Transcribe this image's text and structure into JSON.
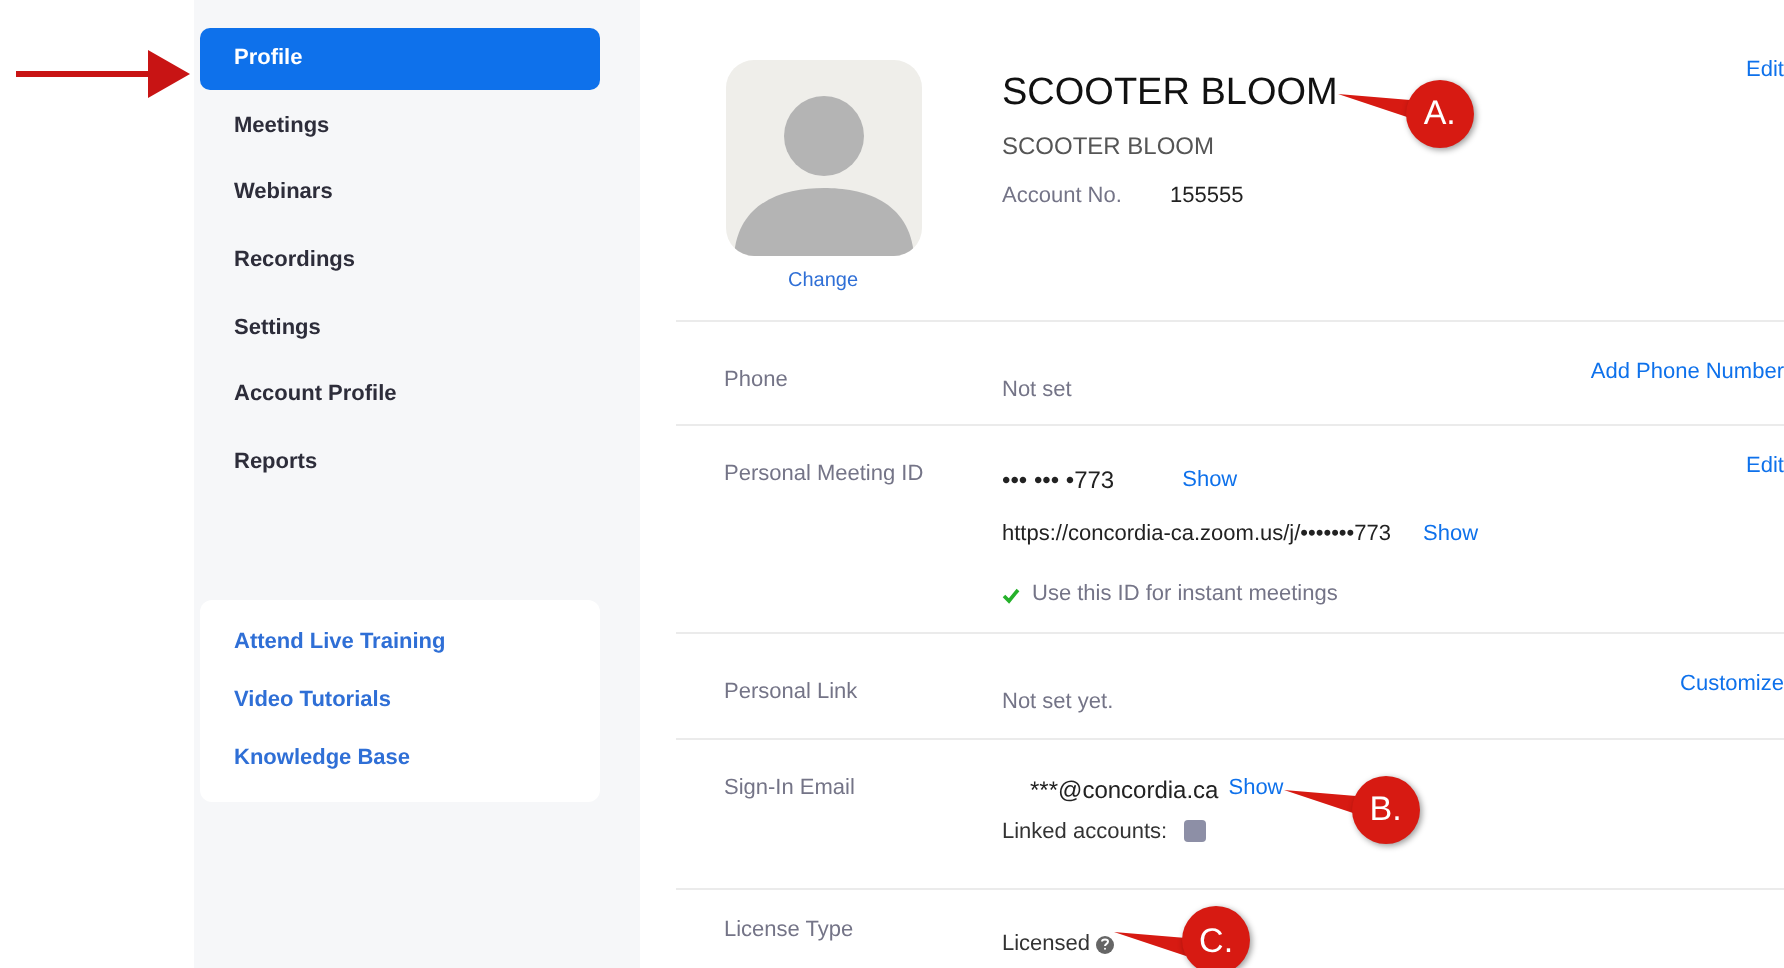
{
  "sidebar": {
    "nav": [
      {
        "label": "Profile",
        "selected": true
      },
      {
        "label": "Meetings",
        "selected": false
      },
      {
        "label": "Webinars",
        "selected": false
      },
      {
        "label": "Recordings",
        "selected": false
      },
      {
        "label": "Settings",
        "selected": false
      },
      {
        "label": "Account Profile",
        "selected": false
      },
      {
        "label": "Reports",
        "selected": false
      }
    ],
    "links": [
      "Attend Live Training",
      "Video Tutorials",
      "Knowledge Base"
    ]
  },
  "profile": {
    "name": "SCOOTER BLOOM",
    "callout": "A.",
    "display_name": "SCOOTER BLOOM",
    "account_label": "Account No.",
    "account_no": "155555",
    "change_link": "Change",
    "edit_link": "Edit"
  },
  "rows": [
    {
      "kind": "simple",
      "label": "Phone",
      "value": "Not set",
      "action": "Add Phone Number"
    },
    {
      "kind": "meeting_id",
      "label": "Personal Meeting ID",
      "value": "••• ••• •773",
      "show": "Show",
      "url": "https://concordia-ca.zoom.us/j/•••••••773",
      "url_show": "Show",
      "check_text": "Use this ID for instant meetings",
      "checked": true,
      "action": "Edit"
    },
    {
      "kind": "simple",
      "label": "Personal Link",
      "value": "Not set yet.",
      "action": "Customize"
    },
    {
      "kind": "email",
      "label": "Sign-In Email",
      "value": "***@concordia.ca",
      "show": "Show",
      "callout": "B.",
      "linked_label": "Linked accounts:"
    },
    {
      "kind": "license",
      "label": "License Type",
      "value": "Licensed",
      "callout": "C."
    }
  ]
}
